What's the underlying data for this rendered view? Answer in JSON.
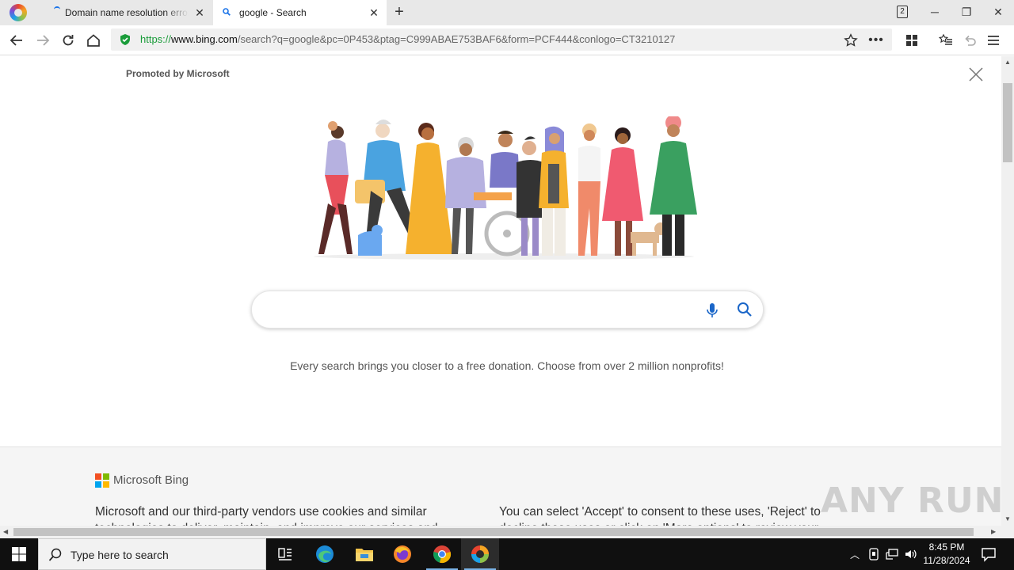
{
  "tabs": [
    {
      "label": "Domain name resolution error",
      "active": false
    },
    {
      "label": "google - Search",
      "active": true
    }
  ],
  "tab_count": "2",
  "address_bar": {
    "scheme": "https://",
    "host": "www.bing.com",
    "path": "/search?q=google&pc=0P453&ptag=C999ABAE753BAF6&form=PCF444&conlogo=CT3210127"
  },
  "page": {
    "promoted_label": "Promoted by Microsoft",
    "search": {
      "value": "",
      "placeholder": ""
    },
    "tagline": "Every search brings you closer to a free donation. Choose from over 2 million nonprofits!"
  },
  "consent": {
    "brand": "Microsoft Bing",
    "left_text": "Microsoft and our third-party vendors use cookies and similar technologies to deliver, maintain, and improve our services and",
    "right_text": "You can select 'Accept' to consent to these uses, 'Reject' to decline these uses or click on 'More options' to review your"
  },
  "watermark": "ANY RUN",
  "taskbar": {
    "search_placeholder": "Type here to search",
    "apps": [
      "task-view",
      "edge",
      "file-explorer",
      "firefox",
      "chrome",
      "browser"
    ],
    "time": "8:45 PM",
    "date": "11/28/2024"
  },
  "colors": {
    "url_scheme": "#1a9c3a",
    "shield": "#1a9c3a",
    "ms_red": "#f25022",
    "ms_green": "#7fba00",
    "ms_blue": "#00a4ef",
    "ms_yellow": "#ffb900",
    "taskbar_bg": "#101010"
  }
}
